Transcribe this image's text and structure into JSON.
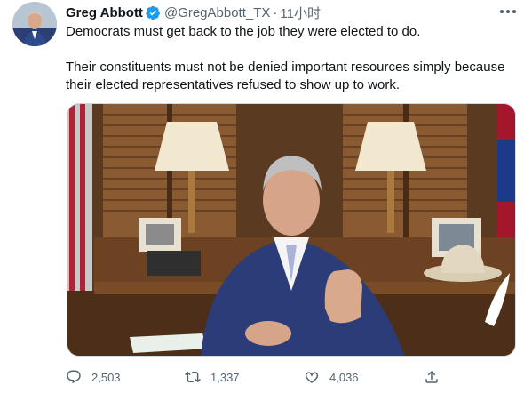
{
  "tweet": {
    "author_name": "Greg Abbott",
    "handle": "@GregAbbott_TX",
    "separator": "·",
    "time": "11小时",
    "text_line1": "Democrats must get back to the job they were elected to do.",
    "text_line2": "Their constituents must not be denied important resources simply because their elected representatives refused to show up to work."
  },
  "actions": {
    "replies": "2,503",
    "retweets": "1,337",
    "likes": "4,036"
  },
  "icons": {
    "verified": "verified-badge-icon",
    "more": "more-options-icon",
    "reply": "reply-icon",
    "retweet": "retweet-icon",
    "like": "like-heart-icon",
    "share": "share-icon"
  },
  "colors": {
    "verified": "#1d9bf0",
    "secondary_text": "#536471",
    "primary_text": "#0f1419"
  }
}
